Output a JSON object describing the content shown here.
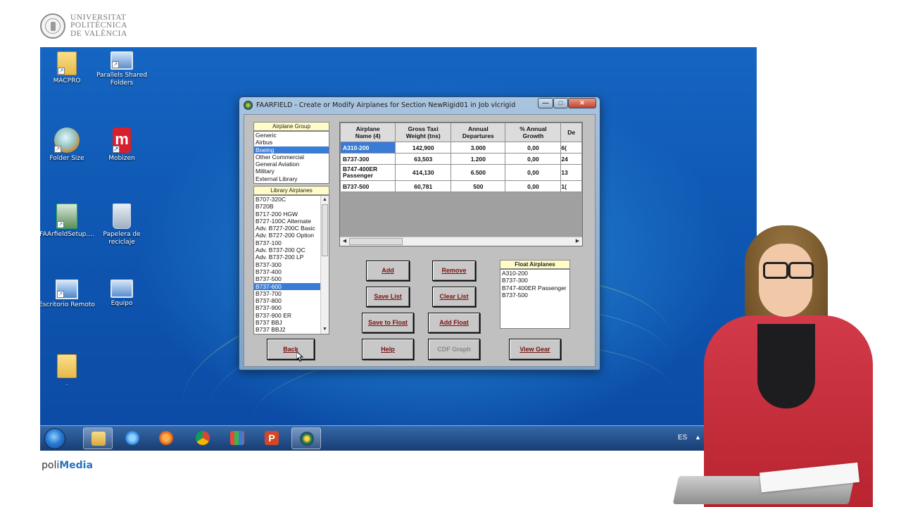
{
  "branding": {
    "university_lines": [
      "UNIVERSITAT",
      "POLITÈCNICA",
      "DE VALÈNCIA"
    ],
    "footer_prefix": "poli",
    "footer_suffix": "Media"
  },
  "desktop_icons": [
    {
      "label": "MACPRO",
      "icon": "folder-icon"
    },
    {
      "label": "Parallels Shared\nFolders",
      "icon": "monitor-icon"
    },
    {
      "label": "Folder Size",
      "icon": "magnifier-icon"
    },
    {
      "label": "Mobizen",
      "icon": "mobizen-icon"
    },
    {
      "label": "FAArfieldSetup....",
      "icon": "setup-icon"
    },
    {
      "label": "Papelera de\nreciclaje",
      "icon": "recycle-bin-icon"
    },
    {
      "label": "Escritorio Remoto",
      "icon": "remote-desktop-icon"
    },
    {
      "label": "Equipo",
      "icon": "computer-icon"
    },
    {
      "label": ".",
      "icon": "folder-icon"
    }
  ],
  "dialog": {
    "title": "FAARFIELD - Create or Modify Airplanes for Section NewRigid01 in Job vlcrigid",
    "window_buttons": {
      "minimize": "—",
      "maximize": "□",
      "close": "✕"
    },
    "airplane_group": {
      "header": "Airplane Group",
      "items": [
        "Generic",
        "Airbus",
        "Boeing",
        "Other Commercial",
        "General Aviation",
        "Military",
        "External Library"
      ],
      "selected": "Boeing"
    },
    "library_airplanes": {
      "header": "Library Airplanes",
      "items": [
        "B707-320C",
        "B720B",
        "B717-200 HGW",
        "B727-100C Alternate",
        "Adv. B727-200C Basic",
        "Adv. B727-200 Option",
        "B737-100",
        "Adv. B737-200 QC",
        "Adv. B737-200 LP",
        "B737-300",
        "B737-400",
        "B737-500",
        "B737-600",
        "B737-700",
        "B737-800",
        "B737-900",
        "B737-900 ER",
        "B737 BBJ",
        "B737 BBJ2"
      ],
      "selected": "B737-600"
    },
    "grid": {
      "headers": [
        [
          "Airplane",
          "Name (4)"
        ],
        [
          "Gross Taxi",
          "Weight (tns)"
        ],
        [
          "Annual",
          "Departures"
        ],
        [
          "% Annual",
          "Growth"
        ],
        [
          "De",
          ""
        ]
      ],
      "rows": [
        {
          "name": "A310-200",
          "weight": "142,900",
          "departures": "3.000",
          "growth": "0,00",
          "extra": "6(",
          "selected": true
        },
        {
          "name": "B737-300",
          "weight": "63,503",
          "departures": "1.200",
          "growth": "0,00",
          "extra": "24",
          "selected": false
        },
        {
          "name": "B747-400ER Passenger",
          "weight": "414,130",
          "departures": "6.500",
          "growth": "0,00",
          "extra": "13",
          "selected": false
        },
        {
          "name": "B737-500",
          "weight": "60,781",
          "departures": "500",
          "growth": "0,00",
          "extra": "1(",
          "selected": false
        }
      ]
    },
    "float_airplanes": {
      "header": "Float Airplanes",
      "items": [
        "A310-200",
        "B737-300",
        "B747-400ER Passenger",
        "B737-500"
      ]
    },
    "buttons": {
      "add": "Add",
      "remove": "Remove",
      "save_list": "Save List",
      "clear_list": "Clear List",
      "save_to_float": "Save to Float",
      "add_float": "Add Float",
      "back": "Back",
      "help": "Help",
      "cdf_graph": "CDF Graph",
      "view_gear": "View Gear"
    }
  },
  "taskbar": {
    "items": [
      "start-orb",
      "file-explorer-icon",
      "internet-explorer-icon",
      "media-player-icon",
      "chrome-icon",
      "app-grid-icon",
      "powerpoint-icon",
      "faarfield-icon"
    ],
    "active": "faarfield-icon",
    "tray_language": "ES",
    "tray_arrow": "▲"
  }
}
